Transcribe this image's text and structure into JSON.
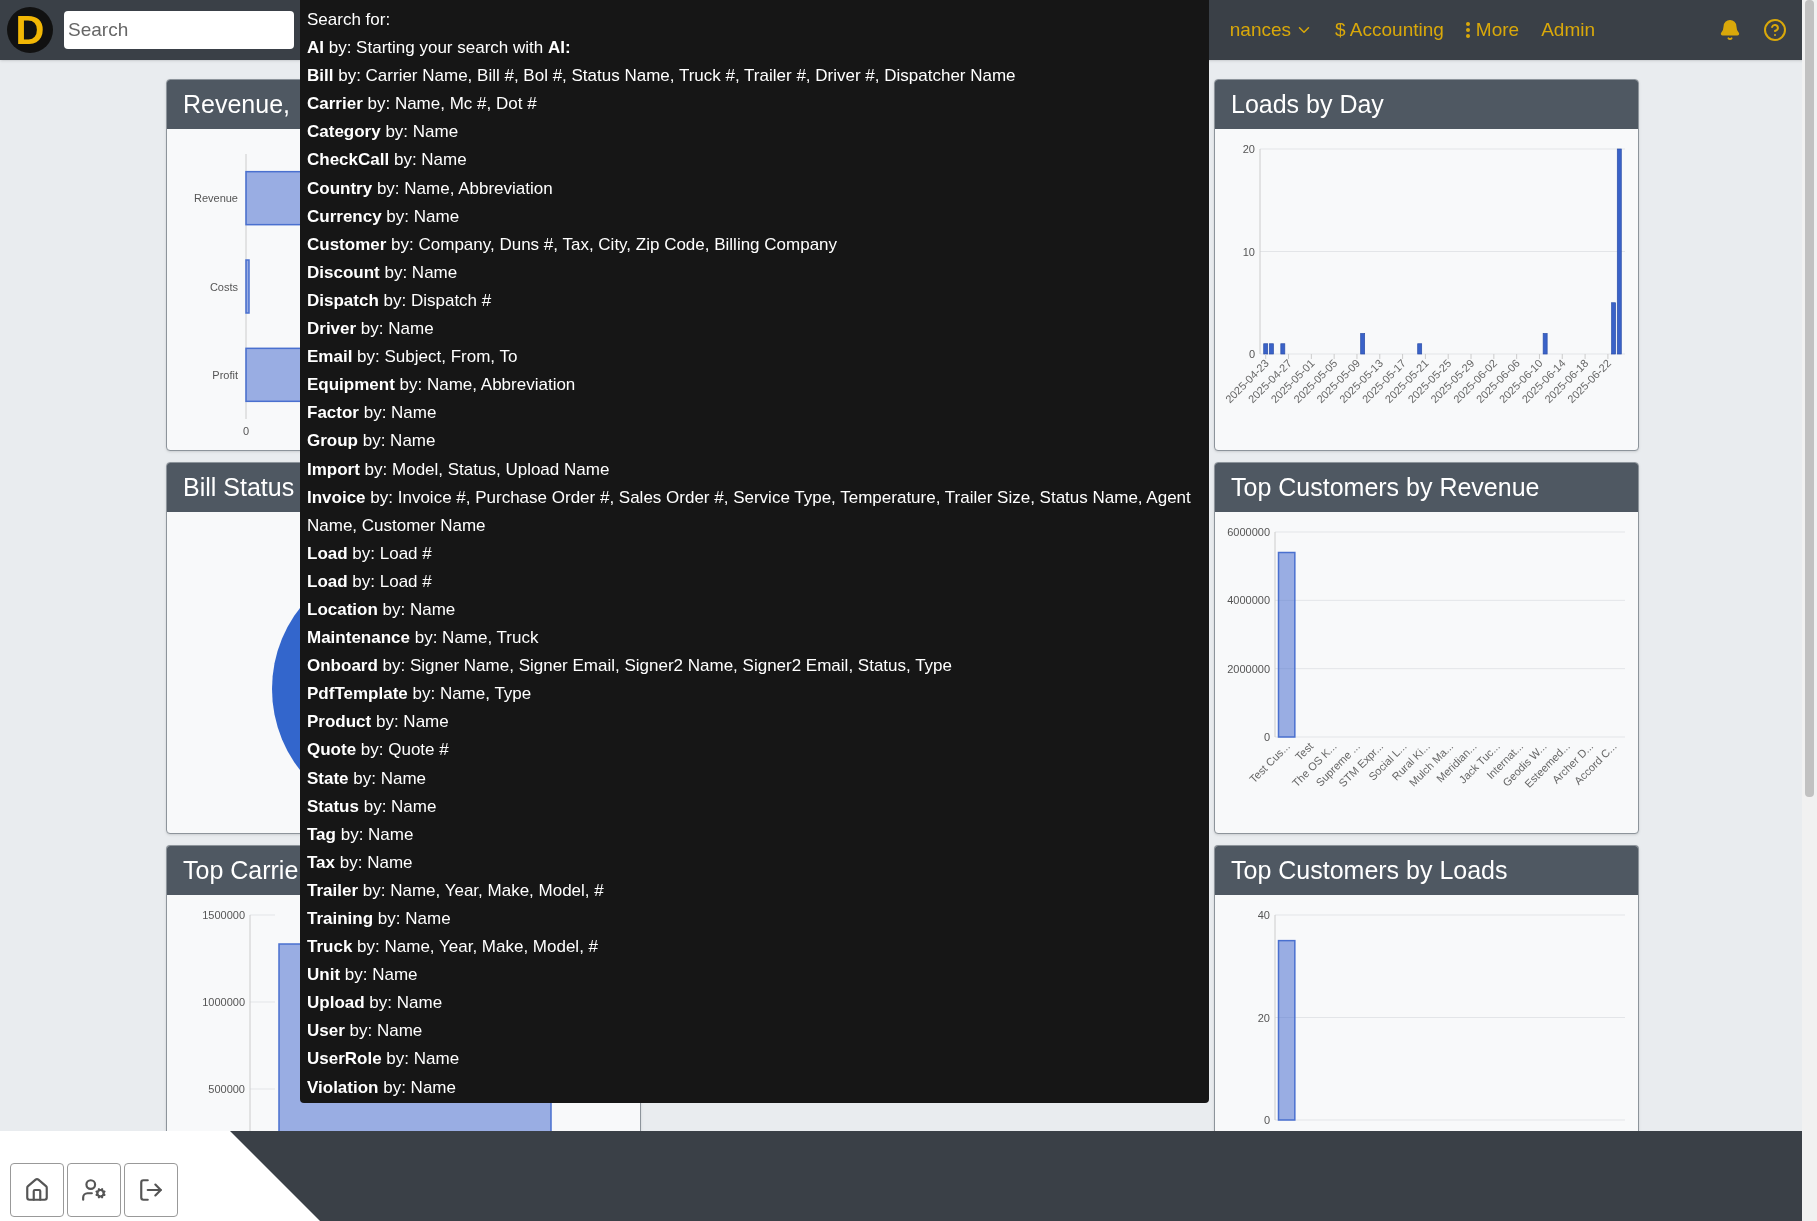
{
  "header": {
    "logo": {
      "letter": "D"
    },
    "search": {
      "placeholder": "Search"
    },
    "nav_items": [
      {
        "label": "nances",
        "kind": "dropdown"
      },
      {
        "label": "$ Accounting",
        "kind": "link"
      },
      {
        "label": "More",
        "kind": "more"
      },
      {
        "label": "Admin",
        "kind": "link"
      }
    ]
  },
  "search_help": {
    "heading": "Search for:",
    "lines": [
      "**AI** by: Starting your search with **AI:**",
      "**Bill** by: Carrier Name, Bill #, Bol #, Status Name, Truck #, Trailer #, Driver #, Dispatcher Name",
      "**Carrier** by: Name, Mc #, Dot #",
      "**Category** by: Name",
      "**CheckCall** by: Name",
      "**Country** by: Name, Abbreviation",
      "**Currency** by: Name",
      "**Customer** by: Company, Duns #, Tax, City, Zip Code, Billing Company",
      "**Discount** by: Name",
      "**Dispatch** by: Dispatch #",
      "**Driver** by: Name",
      "**Email** by: Subject, From, To",
      "**Equipment** by: Name, Abbreviation",
      "**Factor** by: Name",
      "**Group** by: Name",
      "**Import** by: Model, Status, Upload Name",
      "**Invoice** by: Invoice #, Purchase Order #, Sales Order #, Service Type, Temperature, Trailer Size, Status Name, Agent Name, Customer Name",
      "**Load** by: Load #",
      "**Load** by: Load #",
      "**Location** by: Name",
      "**Maintenance** by: Name, Truck",
      "**Onboard** by: Signer Name, Signer Email, Signer2 Name, Signer2 Email, Status, Type",
      "**PdfTemplate** by: Name, Type",
      "**Product** by: Name",
      "**Quote** by: Quote #",
      "**State** by: Name",
      "**Status** by: Name",
      "**Tag** by: Name",
      "**Tax** by: Name",
      "**Trailer** by: Name, Year, Make, Model, #",
      "**Training** by: Name",
      "**Truck** by: Name, Year, Make, Model, #",
      "**Unit** by: Name",
      "**Upload** by: Name",
      "**User** by: Name",
      "**UserRole** by: Name",
      "**Violation** by: Name"
    ]
  },
  "left_cards": [
    {
      "title": "Revenue,",
      "kind": "hbar",
      "axis": {
        "labels": [
          "Revenue",
          "Costs",
          "Profit"
        ],
        "tick": "0"
      }
    },
    {
      "title": "Bill Status",
      "kind": "pie"
    },
    {
      "title": "Top Carrie",
      "kind": "stub",
      "axis": {
        "ticks": [
          "1500000",
          "1000000",
          "500000"
        ]
      }
    }
  ],
  "right_cards": [
    {
      "title": "Loads by Day",
      "kind": "dates",
      "chart_data": {
        "type": "bar",
        "x": [
          "2025-04-23",
          "2025-04-24",
          "2025-04-26",
          "2025-05-10",
          "2025-05-20",
          "2025-06-11",
          "2025-06-23",
          "2025-06-24"
        ],
        "series": [
          {
            "color": "#3a62c8",
            "values": [
              1,
              1,
              1,
              2,
              1,
              2,
              5,
              20
            ]
          }
        ],
        "ylim": [
          0,
          20
        ],
        "yticks": [
          0,
          10,
          20
        ],
        "xlim": [
          "2025-04-22",
          "2025-06-25"
        ],
        "xticks": [
          "2025-04-23",
          "2025-04-27",
          "2025-05-01",
          "2025-05-05",
          "2025-05-09",
          "2025-05-13",
          "2025-05-17",
          "2025-05-21",
          "2025-05-25",
          "2025-05-29",
          "2025-06-02",
          "2025-06-06",
          "2025-06-10",
          "2025-06-14",
          "2025-06-18",
          "2025-06-22"
        ]
      }
    },
    {
      "title": "Top Customers by Revenue",
      "kind": "vbar",
      "chart_data": {
        "type": "bar",
        "categories": [
          "Test Cus...",
          "Test",
          "The OS K...",
          "Supreme ...",
          "STM Expr...",
          "Social L...",
          "Rural Ki...",
          "Mulch Ma...",
          "Meridian...",
          "Jack Tuc...",
          "Internat...",
          "Geodis W...",
          "Esteemed...",
          "Archer D...",
          "Accord C..."
        ],
        "series": [
          {
            "color": "#4a70cf",
            "values": [
              5400000,
              0,
              0,
              0,
              0,
              0,
              0,
              0,
              0,
              0,
              0,
              0,
              0,
              0,
              0
            ]
          }
        ],
        "ylim": [
          0,
          6000000
        ],
        "yticks": [
          0,
          2000000,
          4000000,
          6000000
        ]
      }
    },
    {
      "title": "Top Customers by Loads",
      "kind": "vbar",
      "chart_data": {
        "type": "bar",
        "series": [
          {
            "color": "#4a70cf",
            "values": [
              35
            ]
          }
        ],
        "ylim": [
          0,
          40
        ],
        "yticks": [
          0,
          20,
          40
        ]
      }
    }
  ]
}
